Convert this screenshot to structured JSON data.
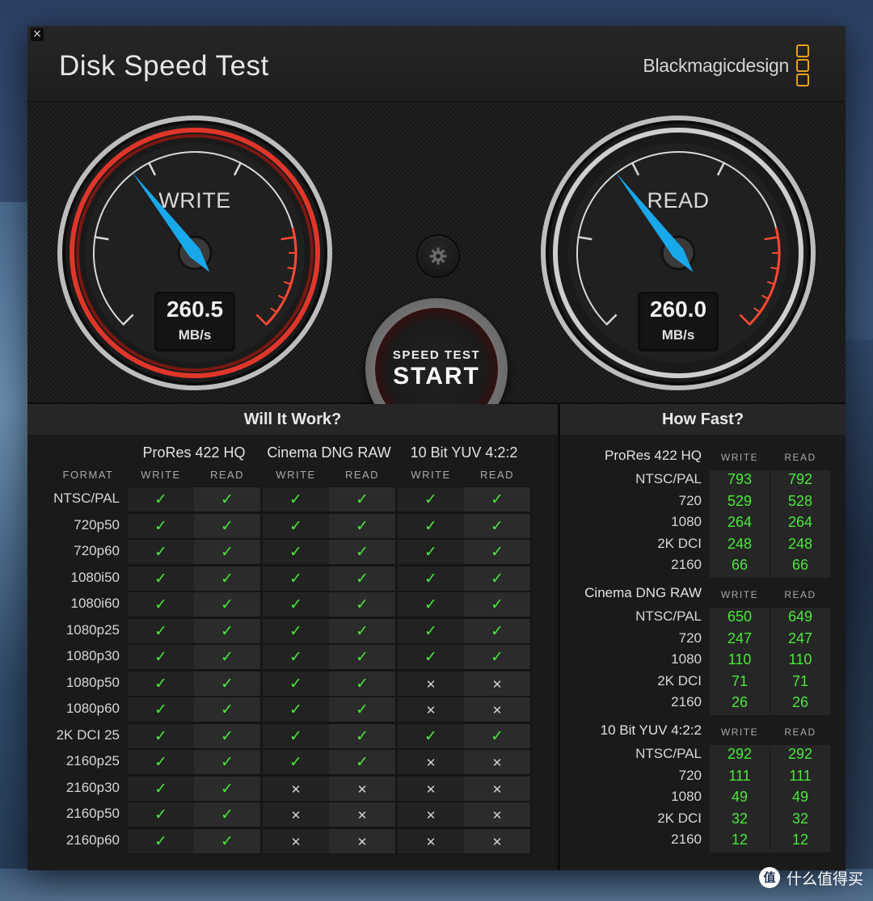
{
  "app": {
    "title": "Disk Speed Test",
    "brand": "Blackmagicdesign",
    "accent_color": "#e8a11a"
  },
  "gauges": {
    "write": {
      "label": "WRITE",
      "value": "260.5",
      "unit": "MB/s",
      "needle_fraction": 0.36,
      "ring_color": "#e0362a"
    },
    "read": {
      "label": "READ",
      "value": "260.0",
      "unit": "MB/s",
      "needle_fraction": 0.36,
      "ring_color": "#cfcfcf"
    }
  },
  "start_button": {
    "small": "SPEED TEST",
    "big": "START"
  },
  "icons": {
    "close": "close-icon",
    "settings": "gear-icon"
  },
  "will_it_work": {
    "title": "Will It Work?",
    "format_header": "FORMAT",
    "groups": [
      {
        "name": "ProRes 422 HQ",
        "write": "WRITE",
        "read": "READ"
      },
      {
        "name": "Cinema DNG RAW",
        "write": "WRITE",
        "read": "READ"
      },
      {
        "name": "10 Bit YUV 4:2:2",
        "write": "WRITE",
        "read": "READ"
      }
    ],
    "rows": [
      {
        "format": "NTSC/PAL",
        "cells": [
          true,
          true,
          true,
          true,
          true,
          true
        ]
      },
      {
        "format": "720p50",
        "cells": [
          true,
          true,
          true,
          true,
          true,
          true
        ]
      },
      {
        "format": "720p60",
        "cells": [
          true,
          true,
          true,
          true,
          true,
          true
        ]
      },
      {
        "format": "1080i50",
        "cells": [
          true,
          true,
          true,
          true,
          true,
          true
        ]
      },
      {
        "format": "1080i60",
        "cells": [
          true,
          true,
          true,
          true,
          true,
          true
        ]
      },
      {
        "format": "1080p25",
        "cells": [
          true,
          true,
          true,
          true,
          true,
          true
        ]
      },
      {
        "format": "1080p30",
        "cells": [
          true,
          true,
          true,
          true,
          true,
          true
        ]
      },
      {
        "format": "1080p50",
        "cells": [
          true,
          true,
          true,
          true,
          false,
          false
        ]
      },
      {
        "format": "1080p60",
        "cells": [
          true,
          true,
          true,
          true,
          false,
          false
        ]
      },
      {
        "format": "2K DCI 25",
        "cells": [
          true,
          true,
          true,
          true,
          true,
          true
        ]
      },
      {
        "format": "2160p25",
        "cells": [
          true,
          true,
          true,
          true,
          false,
          false
        ]
      },
      {
        "format": "2160p30",
        "cells": [
          true,
          true,
          false,
          false,
          false,
          false
        ]
      },
      {
        "format": "2160p50",
        "cells": [
          true,
          true,
          false,
          false,
          false,
          false
        ]
      },
      {
        "format": "2160p60",
        "cells": [
          true,
          true,
          false,
          false,
          false,
          false
        ]
      }
    ],
    "check_glyph": "✓",
    "cross_glyph": "✕"
  },
  "how_fast": {
    "title": "How Fast?",
    "write_header": "WRITE",
    "read_header": "READ",
    "groups": [
      {
        "name": "ProRes 422 HQ",
        "rows": [
          {
            "label": "NTSC/PAL",
            "write": "793",
            "read": "792"
          },
          {
            "label": "720",
            "write": "529",
            "read": "528"
          },
          {
            "label": "1080",
            "write": "264",
            "read": "264"
          },
          {
            "label": "2K DCI",
            "write": "248",
            "read": "248"
          },
          {
            "label": "2160",
            "write": "66",
            "read": "66"
          }
        ]
      },
      {
        "name": "Cinema DNG RAW",
        "rows": [
          {
            "label": "NTSC/PAL",
            "write": "650",
            "read": "649"
          },
          {
            "label": "720",
            "write": "247",
            "read": "247"
          },
          {
            "label": "1080",
            "write": "110",
            "read": "110"
          },
          {
            "label": "2K DCI",
            "write": "71",
            "read": "71"
          },
          {
            "label": "2160",
            "write": "26",
            "read": "26"
          }
        ]
      },
      {
        "name": "10 Bit YUV 4:2:2",
        "rows": [
          {
            "label": "NTSC/PAL",
            "write": "292",
            "read": "292"
          },
          {
            "label": "720",
            "write": "111",
            "read": "111"
          },
          {
            "label": "1080",
            "write": "49",
            "read": "49"
          },
          {
            "label": "2K DCI",
            "write": "32",
            "read": "32"
          },
          {
            "label": "2160",
            "write": "12",
            "read": "12"
          }
        ]
      }
    ]
  },
  "watermark": {
    "logo": "值",
    "text": "什么值得买"
  },
  "colors": {
    "ok": "#49e83a",
    "cross": "#d0d0d0",
    "value": "#49e83a"
  }
}
